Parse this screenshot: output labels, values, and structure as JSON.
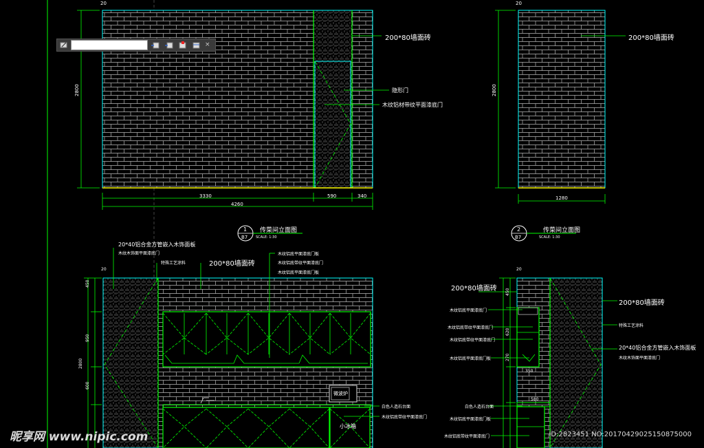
{
  "toolbar": {
    "input_value": ""
  },
  "elev1": {
    "dim_height": "2800",
    "dim_top": "20",
    "dim_a": "3330",
    "dim_b": "590",
    "dim_c": "340",
    "dim_total": "4260",
    "label_tile": "200*80墙面砖",
    "label_door": "隐形门",
    "label_door2": "木纹铝材带纹平面漆底门",
    "title_num": "1",
    "title_sheet": "B7",
    "title_text": "传菜间立面图",
    "title_scale": "SCALE: 1:30"
  },
  "elev2": {
    "dim_height": "2800",
    "dim_top": "20",
    "dim_w": "1280",
    "label_tile": "200*80墙面砖",
    "title_num": "2",
    "title_sheet": "B7",
    "title_text": "传菜间立面图",
    "title_scale": "SCALE: 1:30"
  },
  "elev3": {
    "label_alu": "20*40铝合金方管嵌入木饰面板",
    "label_alu2": "木纹木饰面平面漆底门",
    "label_tile": "200*80墙面砖",
    "label_paint": "特殊工艺涂料",
    "label_cab1": "木纹铝底平面漆底门板",
    "label_cab2": "木纹铝底带纹平面漆底门",
    "label_cab3": "木纹铝底平面漆底门板",
    "label_counter": "白色人造石台面",
    "label_cab4": "木纹铝底带纹平面漆底门",
    "label_micro": "微波炉",
    "label_fridge": "小冰箱",
    "dims": [
      "450",
      "950",
      "600",
      "2800",
      "20"
    ]
  },
  "elev4": {
    "label_tile": "200*80墙面砖",
    "l1": "木纹铝底平面漆底门",
    "l2": "木纹铝底带纹平面漆底门",
    "l3": "木纹铝底带纹平面漆底门",
    "l4": "木纹铝底平面漆底门板",
    "l5": "白色人造石台面",
    "l6": "木纹铝底平面漆底门板",
    "l7": "木纹铝底带纹平面漆底门",
    "r_tile": "200*80墙面砖",
    "r_paint": "特殊工艺涂料",
    "r_alu": "20*40铝合金方管嵌入木饰面板",
    "r_alu2": "木纹木饰面平面漆底门",
    "dims": [
      "450",
      "620",
      "270",
      "350",
      "580",
      "20"
    ]
  },
  "watermark": {
    "left": "昵享网 www.nipic.com",
    "right": "ID:2823451 NO:20170429025150875000"
  },
  "colors": {
    "bg": "#000000",
    "line": "#00ff00",
    "wall": "#c8c8c8",
    "dim": "#00ff00",
    "label": "#ffffff",
    "yellow": "#ffff00",
    "cyan": "#00ffff"
  }
}
